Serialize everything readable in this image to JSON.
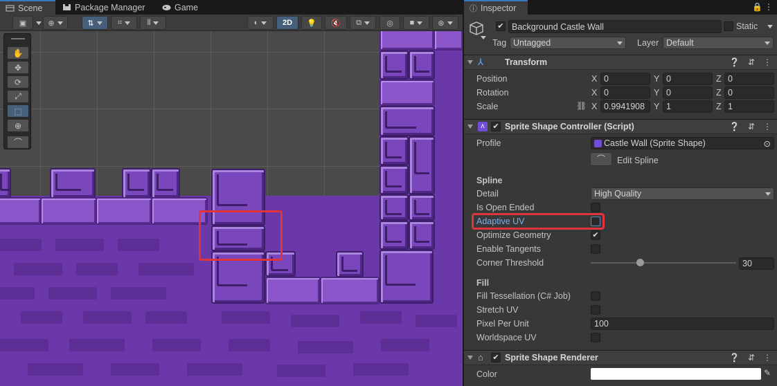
{
  "scene_panel": {
    "tabs": [
      {
        "label": "Scene",
        "icon": "scene-icon"
      },
      {
        "label": "Package Manager",
        "icon": "package-icon"
      },
      {
        "label": "Game",
        "icon": "gamepad-icon"
      }
    ],
    "toolbar": {
      "mode_2d_label": "2D"
    }
  },
  "inspector": {
    "tab_label": "Inspector",
    "object_name": "Background Castle Wall",
    "static_label": "Static",
    "tag_label": "Tag",
    "tag_value": "Untagged",
    "layer_label": "Layer",
    "layer_value": "Default",
    "transform": {
      "title": "Transform",
      "position_label": "Position",
      "rotation_label": "Rotation",
      "scale_label": "Scale",
      "axes": {
        "x": "X",
        "y": "Y",
        "z": "Z"
      },
      "position": {
        "x": "0",
        "y": "0",
        "z": "0"
      },
      "rotation": {
        "x": "0",
        "y": "0",
        "z": "0"
      },
      "scale": {
        "x": "0.9941908",
        "y": "1",
        "z": "1"
      }
    },
    "sprite_shape_controller": {
      "title": "Sprite Shape Controller (Script)",
      "profile_label": "Profile",
      "profile_value": "Castle Wall (Sprite Shape)",
      "edit_spline_label": "Edit Spline",
      "spline_section": "Spline",
      "detail_label": "Detail",
      "detail_value": "High Quality",
      "is_open_ended_label": "Is Open Ended",
      "adaptive_uv_label": "Adaptive UV",
      "optimize_geometry_label": "Optimize Geometry",
      "enable_tangents_label": "Enable Tangents",
      "corner_threshold_label": "Corner Threshold",
      "corner_threshold_value": "30",
      "corner_threshold_fraction": 0.34,
      "fill_section": "Fill",
      "fill_tessellation_label": "Fill Tessellation (C# Job)",
      "stretch_uv_label": "Stretch UV",
      "pixel_per_unit_label": "Pixel Per Unit",
      "pixel_per_unit_value": "100",
      "worldspace_uv_label": "Worldspace UV",
      "checks": {
        "is_open_ended": false,
        "adaptive_uv": false,
        "optimize_geometry": true,
        "enable_tangents": false,
        "fill_tessellation": false,
        "stretch_uv": false,
        "worldspace_uv": false
      }
    },
    "sprite_shape_renderer": {
      "title": "Sprite Shape Renderer",
      "color_label": "Color"
    }
  },
  "colors": {
    "accent": "#3a79bb",
    "highlight": "#e0343b",
    "wall": "#6a38a8"
  }
}
